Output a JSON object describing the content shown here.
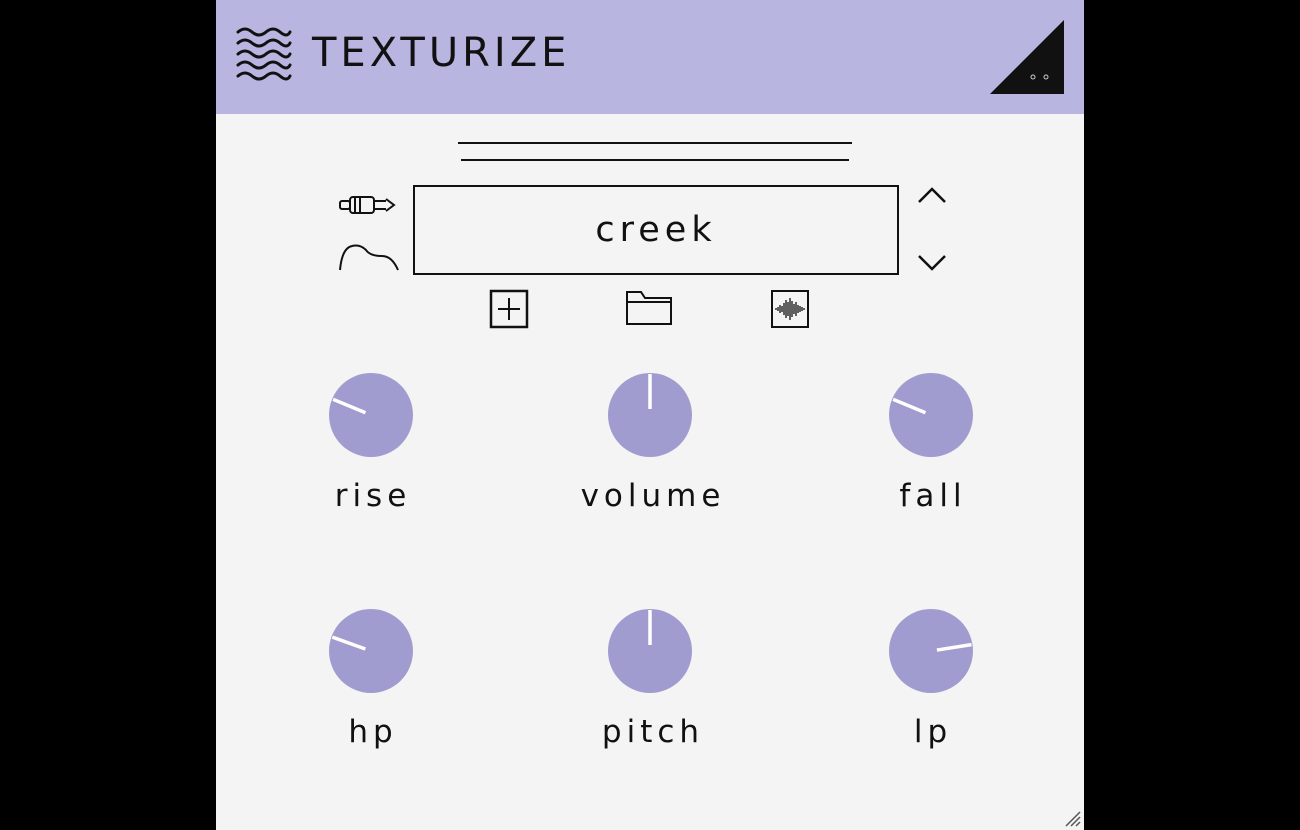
{
  "header": {
    "title": "TEXTURIZE",
    "logo_icon": "waves-icon",
    "corner_icon": "triangle-menu-icon",
    "background": "#b8b5e0"
  },
  "preset": {
    "name": "creek",
    "input_icon": "audio-jack-icon",
    "envelope_icon": "envelope-curve-icon",
    "prev_icon": "chevron-up-icon",
    "next_icon": "chevron-down-icon"
  },
  "actions": [
    {
      "icon": "add-square-icon"
    },
    {
      "icon": "folder-icon"
    },
    {
      "icon": "waveform-icon"
    }
  ],
  "knobs": [
    {
      "label": "rise",
      "value": 0.25
    },
    {
      "label": "volume",
      "value": 0.5
    },
    {
      "label": "fall",
      "value": 0.25
    },
    {
      "label": "hp",
      "value": 0.24
    },
    {
      "label": "pitch",
      "value": 0.5
    },
    {
      "label": "lp",
      "value": 0.8
    }
  ],
  "colors": {
    "knob": "#a19ccf",
    "indicator": "#ffffff",
    "panel": "#f4f4f4",
    "ink": "#111111"
  }
}
